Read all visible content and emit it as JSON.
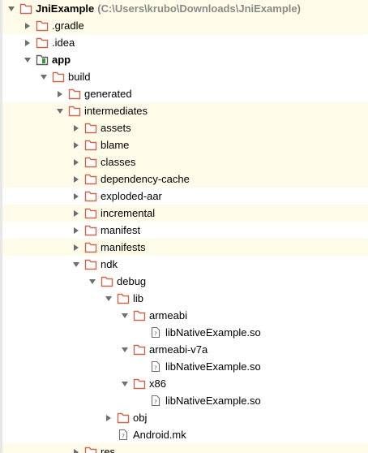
{
  "project": {
    "name": "JniExample",
    "path": "(C:\\Users\\krubo\\Downloads\\JniExample)"
  },
  "colors": {
    "folder_outline": "#c7684f",
    "module_outline": "#5a5a5a",
    "module_badge": "#3f9a3f",
    "file_outline": "#707070",
    "arrow": "#6e6e6e",
    "row_highlight": "#fefce8"
  },
  "tree": [
    {
      "name": "JniExample",
      "depth": 0,
      "expanded": true,
      "icon": "project-folder-icon",
      "bold": true,
      "path": true,
      "hl": true
    },
    {
      "name": ".gradle",
      "depth": 1,
      "expanded": false,
      "icon": "folder-icon",
      "hl": true
    },
    {
      "name": ".idea",
      "depth": 1,
      "expanded": false,
      "icon": "folder-icon",
      "hl": false
    },
    {
      "name": "app",
      "depth": 1,
      "expanded": true,
      "icon": "module-icon",
      "bold": true,
      "hl": false
    },
    {
      "name": "build",
      "depth": 2,
      "expanded": true,
      "icon": "folder-icon",
      "hl": false
    },
    {
      "name": "generated",
      "depth": 3,
      "expanded": false,
      "icon": "folder-icon",
      "hl": false
    },
    {
      "name": "intermediates",
      "depth": 3,
      "expanded": true,
      "icon": "folder-icon",
      "hl": true
    },
    {
      "name": "assets",
      "depth": 4,
      "expanded": false,
      "icon": "folder-icon",
      "hl": true
    },
    {
      "name": "blame",
      "depth": 4,
      "expanded": false,
      "icon": "folder-icon",
      "hl": true
    },
    {
      "name": "classes",
      "depth": 4,
      "expanded": false,
      "icon": "folder-icon",
      "hl": true
    },
    {
      "name": "dependency-cache",
      "depth": 4,
      "expanded": false,
      "icon": "folder-icon",
      "hl": true
    },
    {
      "name": "exploded-aar",
      "depth": 4,
      "expanded": false,
      "icon": "folder-icon",
      "hl": false
    },
    {
      "name": "incremental",
      "depth": 4,
      "expanded": false,
      "icon": "folder-icon",
      "hl": true
    },
    {
      "name": "manifest",
      "depth": 4,
      "expanded": false,
      "icon": "folder-icon",
      "hl": false
    },
    {
      "name": "manifests",
      "depth": 4,
      "expanded": false,
      "icon": "folder-icon",
      "hl": true
    },
    {
      "name": "ndk",
      "depth": 4,
      "expanded": true,
      "icon": "folder-icon",
      "hl": false
    },
    {
      "name": "debug",
      "depth": 5,
      "expanded": true,
      "icon": "folder-icon",
      "hl": false
    },
    {
      "name": "lib",
      "depth": 6,
      "expanded": true,
      "icon": "folder-icon",
      "hl": false
    },
    {
      "name": "armeabi",
      "depth": 7,
      "expanded": true,
      "icon": "folder-icon",
      "hl": false
    },
    {
      "name": "libNativeExample.so",
      "depth": 8,
      "leaf": true,
      "icon": "file-icon",
      "hl": false
    },
    {
      "name": "armeabi-v7a",
      "depth": 7,
      "expanded": true,
      "icon": "folder-icon",
      "hl": false
    },
    {
      "name": "libNativeExample.so",
      "depth": 8,
      "leaf": true,
      "icon": "file-icon",
      "hl": false
    },
    {
      "name": "x86",
      "depth": 7,
      "expanded": true,
      "icon": "folder-icon",
      "hl": false
    },
    {
      "name": "libNativeExample.so",
      "depth": 8,
      "leaf": true,
      "icon": "file-icon",
      "hl": false
    },
    {
      "name": "obj",
      "depth": 6,
      "expanded": false,
      "icon": "folder-icon",
      "hl": false
    },
    {
      "name": "Android.mk",
      "depth": 6,
      "leaf": true,
      "icon": "file-icon",
      "hl": false
    },
    {
      "name": "res",
      "depth": 4,
      "expanded": false,
      "icon": "folder-icon",
      "hl": true
    }
  ]
}
